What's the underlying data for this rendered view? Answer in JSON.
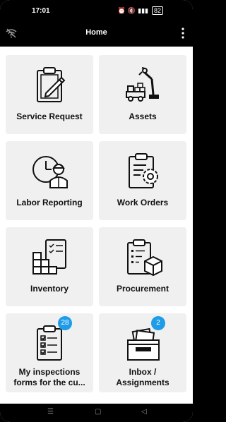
{
  "status": {
    "time": "17:01",
    "battery": "82"
  },
  "header": {
    "title": "Home"
  },
  "tiles": [
    {
      "label": "Service Request",
      "icon": "clipboard-pen-icon"
    },
    {
      "label": "Assets",
      "icon": "forklift-robot-arm-icon"
    },
    {
      "label": "Labor Reporting",
      "icon": "clock-worker-icon"
    },
    {
      "label": "Work Orders",
      "icon": "clipboard-gear-icon"
    },
    {
      "label": "Inventory",
      "icon": "boxes-checklist-icon"
    },
    {
      "label": "Procurement",
      "icon": "clipboard-package-icon"
    },
    {
      "label": "My inspections forms for the cu...",
      "icon": "checklist-icon",
      "badge": "28"
    },
    {
      "label": "Inbox / Assignments",
      "icon": "inbox-tray-icon",
      "badge": "2"
    }
  ],
  "colors": {
    "badge": "#1e9ce8",
    "tile": "#f0f0f0",
    "bar": "#000000"
  }
}
